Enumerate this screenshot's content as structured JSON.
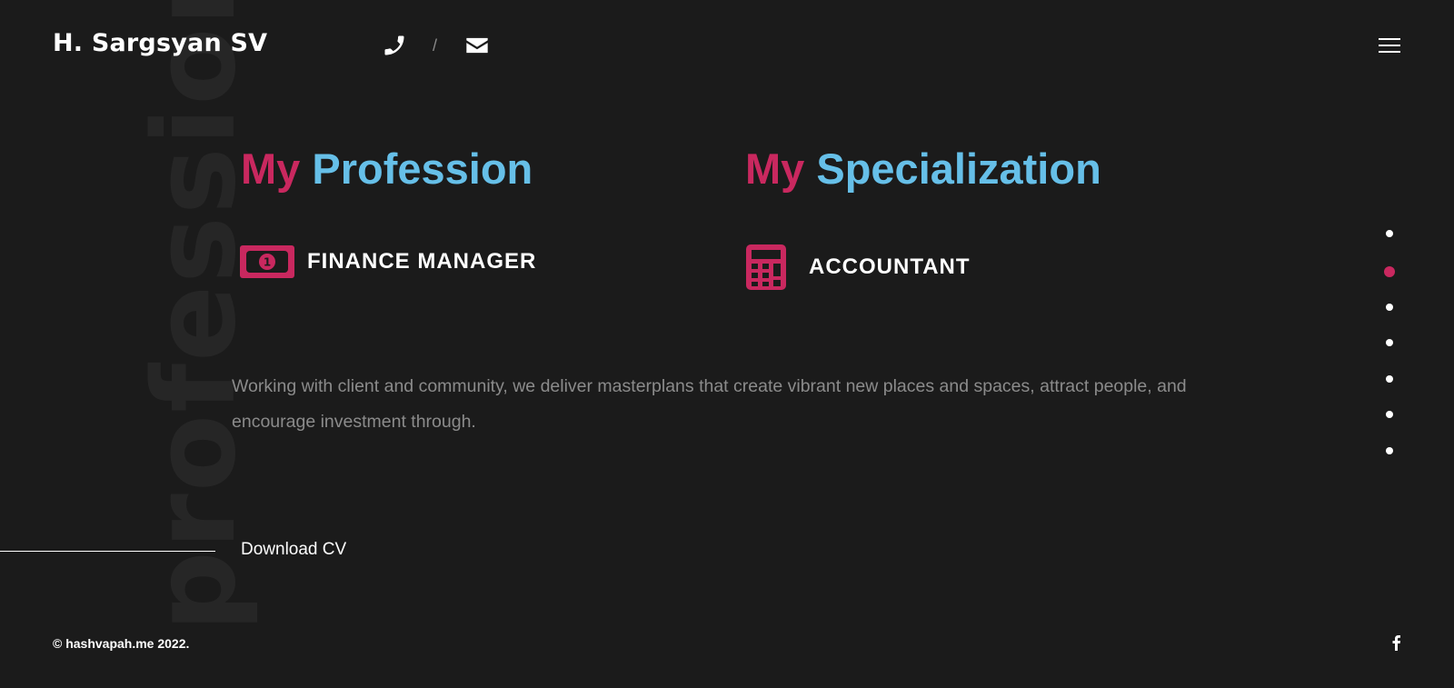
{
  "background_word": "profession",
  "header": {
    "brand": "H. Sargsyan SV",
    "separator": "/",
    "icons": [
      "phone-icon",
      "envelope-icon",
      "hamburger-menu-icon"
    ]
  },
  "sections": {
    "profession": {
      "my": "My",
      "title": "Profession",
      "role": "FINANCE MANAGER",
      "icon": "money-bill-icon"
    },
    "specialization": {
      "my": "My",
      "title": "Specialization",
      "role": "ACCOUNTANT",
      "icon": "calculator-icon"
    }
  },
  "description": "Working with client and community, we deliver masterplans that create vibrant new places and spaces, attract people, and encourage investment through.",
  "cta": {
    "label": "Download CV"
  },
  "footer": {
    "copyright": "© hashvapah.me 2022.",
    "social_icon": "facebook-icon"
  },
  "page_nav": {
    "count": 7,
    "active_index": 1
  },
  "colors": {
    "accent_pink": "#c9285f",
    "accent_blue": "#66bfe8",
    "background": "#1b1b1b",
    "muted_text": "#8b8b8b"
  }
}
